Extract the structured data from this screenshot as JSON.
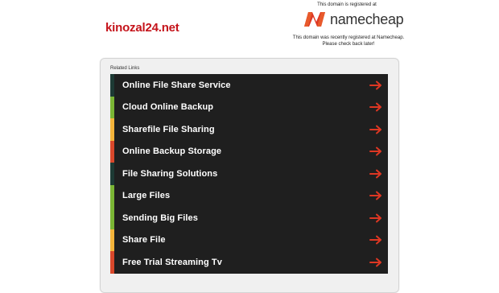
{
  "header": {
    "domain": "kinozal24.net",
    "registered_note": "This domain is registered at",
    "brand_name": "namecheap",
    "brand_color": "#de3723",
    "message_line1": "This domain was recently registered at Namecheap.",
    "message_line2": "Please check back later!"
  },
  "related": {
    "label": "Related Links",
    "arrow_color": "#de3723",
    "items": [
      {
        "label": "Online File Share Service",
        "color": "#1d3a34",
        "icon": "arrow-right-icon"
      },
      {
        "label": "Cloud Online Backup",
        "color": "#7ab534",
        "icon": "arrow-right-icon"
      },
      {
        "label": "Sharefile File Sharing",
        "color": "#f4b43a",
        "icon": "arrow-right-icon"
      },
      {
        "label": "Online Backup Storage",
        "color": "#d9482b",
        "icon": "arrow-right-icon"
      },
      {
        "label": "File Sharing Solutions",
        "color": "#1d3a34",
        "icon": "arrow-right-icon"
      },
      {
        "label": "Large Files",
        "color": "#7ab534",
        "icon": "arrow-right-icon"
      },
      {
        "label": "Sending Big Files",
        "color": "#7ab534",
        "icon": "arrow-right-icon"
      },
      {
        "label": "Share File",
        "color": "#f4b43a",
        "icon": "arrow-right-icon"
      },
      {
        "label": "Free Trial Streaming Tv",
        "color": "#d9482b",
        "icon": "arrow-right-icon"
      }
    ]
  }
}
